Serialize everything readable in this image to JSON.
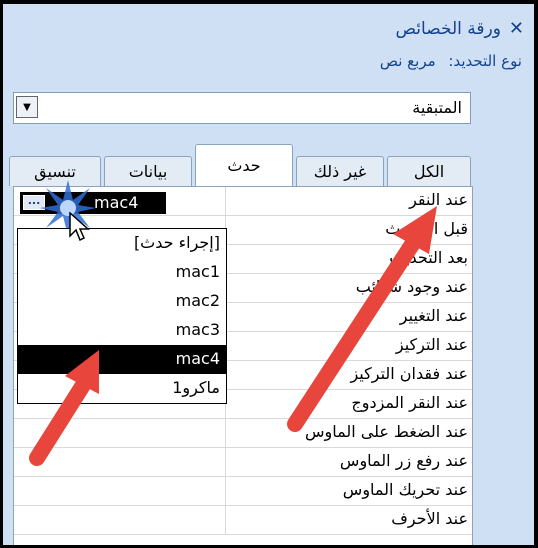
{
  "panel": {
    "title": "ورقة الخصائص",
    "close_icon": "close-icon",
    "selection_type_label": "نوع التحديد:",
    "selection_type_value": "مربع نص"
  },
  "object_combo": {
    "value": "المتبقية",
    "dropdown_icon": "triangle-down-icon"
  },
  "tabs": [
    {
      "label": "تنسيق",
      "active": false
    },
    {
      "label": "بيانات",
      "active": false
    },
    {
      "label": "حدث",
      "active": true
    },
    {
      "label": "غير ذلك",
      "active": false
    },
    {
      "label": "الكل",
      "active": false
    }
  ],
  "properties": [
    "عند النقر",
    "قبل التحديث",
    "بعد التحديث",
    "عند وجود شوائب",
    "عند التغيير",
    "عند التركيز",
    "عند فقدان التركيز",
    "عند النقر المزدوج",
    "عند الضغط على الماوس",
    "عند رفع زر الماوس",
    "عند تحريك الماوس",
    "عند الأحرف"
  ],
  "current_value": "mac4",
  "builder_button_label": "...",
  "dropdown_items": [
    {
      "label": "[إجراء حدث]",
      "selected": false
    },
    {
      "label": "mac1",
      "selected": false
    },
    {
      "label": "mac2",
      "selected": false
    },
    {
      "label": "mac3",
      "selected": false
    },
    {
      "label": "mac4",
      "selected": true
    },
    {
      "label": "ماكرو1",
      "selected": false
    }
  ],
  "colors": {
    "panel_bg": "#cfe0f5",
    "title_text": "#15428b",
    "annotation_arrow": "#e8453c",
    "selection": "#000000"
  }
}
